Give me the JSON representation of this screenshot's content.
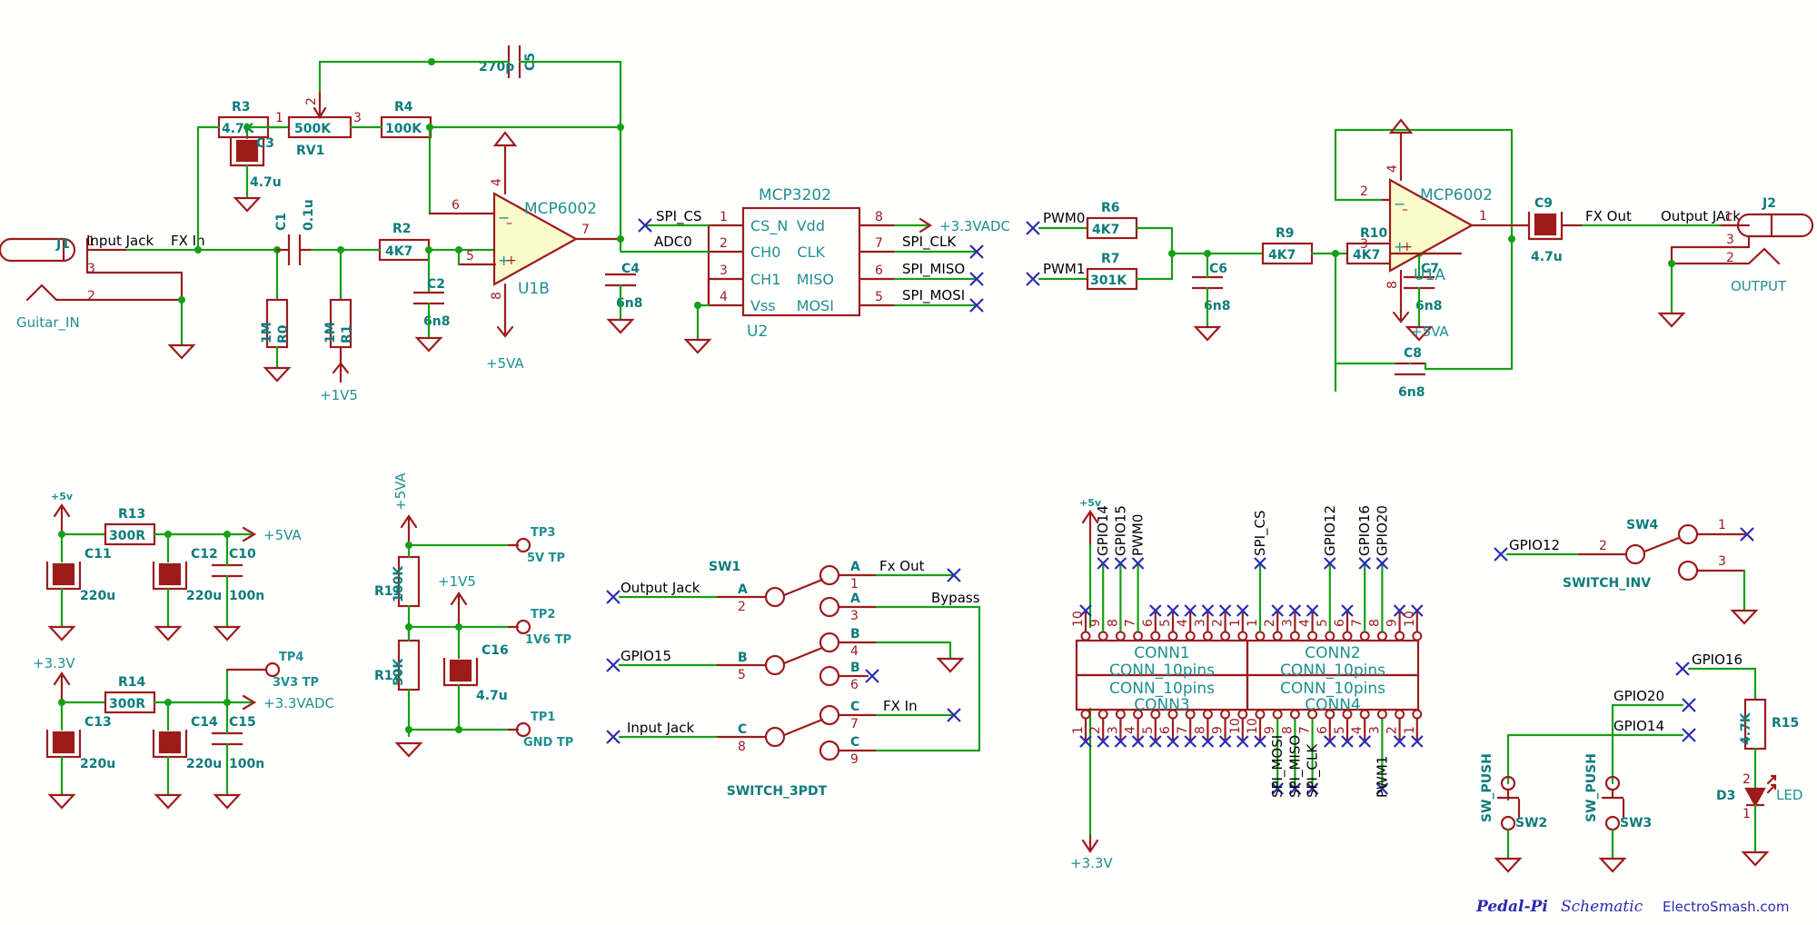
{
  "sheet": {
    "title": "Pedal-Pi Schematic",
    "credit_brand": "Pedal-Pi",
    "credit_word": "Schematic",
    "credit_site": "ElectroSmash.com",
    "colors": {
      "wire_green": "#14a014",
      "symbol_red": "#9d1b1b",
      "label_teal": "#1f8f8f",
      "net_black": "#000000",
      "nc_blue": "#2b2bb0",
      "opamp_fill": "#fafaca",
      "background": "#ffffff"
    }
  },
  "input_stage": {
    "j1_ref": "J1",
    "j1_name": "Guitar_IN",
    "j1_pins": [
      "1",
      "3",
      "2"
    ],
    "net_input_jack": "Input Jack",
    "net_fx_in": "FX In",
    "c1_ref": "C1",
    "c1_val": "0.1u",
    "r0_ref": "R0",
    "r0_val": "1M",
    "r1_ref": "R1",
    "r1_val": "1M",
    "r2_ref": "R2",
    "r2_val": "4K7",
    "c2_ref": "C2",
    "c2_val": "6n8",
    "c3_ref": "C3",
    "c3_val": "4.7u",
    "r3_ref": "R3",
    "r3_val": "4.7K",
    "rv1_ref": "RV1",
    "rv1_val": "500K",
    "rv1_pins": [
      "1",
      "2",
      "3"
    ],
    "r4_ref": "R4",
    "r4_val": "100K",
    "c5_ref": "C5",
    "c5_val": "270p",
    "c4_ref": "C4",
    "c4_val": "6n8",
    "u1b_ref": "U1B",
    "u1b_part": "MCP6002",
    "u1b_pins": [
      "6",
      "5",
      "7",
      "4",
      "8"
    ],
    "pwr_1v5": "+1V5",
    "pwr_5va": "+5VA"
  },
  "adc": {
    "ref": "U2",
    "part": "MCP3202",
    "pins_left": [
      {
        "num": "1",
        "name": "CS_N"
      },
      {
        "num": "2",
        "name": "CH0"
      },
      {
        "num": "3",
        "name": "CH1"
      },
      {
        "num": "4",
        "name": "Vss"
      }
    ],
    "pins_right": [
      {
        "num": "8",
        "name": "Vdd"
      },
      {
        "num": "7",
        "name": "CLK"
      },
      {
        "num": "6",
        "name": "MISO"
      },
      {
        "num": "5",
        "name": "MOSI"
      }
    ],
    "net_cs": "SPI_CS",
    "net_adc0": "ADC0",
    "net_vdd": "+3.3VADC",
    "net_clk": "SPI_CLK",
    "net_miso": "SPI_MISO",
    "net_mosi": "SPI_MOSI"
  },
  "output_stage": {
    "net_pwm0": "PWM0",
    "net_pwm1": "PWM1",
    "r6_ref": "R6",
    "r6_val": "4K7",
    "r7_ref": "R7",
    "r7_val": "301K",
    "c6_ref": "C6",
    "c6_val": "6n8",
    "r9_ref": "R9",
    "r9_val": "4K7",
    "r10_ref": "R10",
    "r10_val": "4K7",
    "c7_ref": "C7",
    "c7_val": "6n8",
    "c8_ref": "C8",
    "c8_val": "6n8",
    "u1a_ref": "U1A",
    "u1a_part": "MCP6002",
    "u1a_pins": [
      "2",
      "3",
      "1",
      "4",
      "8"
    ],
    "pwr_5va": "+5VA",
    "c9_ref": "C9",
    "c9_val": "4.7u",
    "net_fx_out": "FX Out",
    "net_output_jack": "Output JAck",
    "j2_ref": "J2",
    "j2_name": "OUTPUT",
    "j2_pins": [
      "1",
      "3",
      "2"
    ]
  },
  "psu_5v": {
    "rail_in": "+5v",
    "rail_out": "+5VA",
    "r13_ref": "R13",
    "r13_val": "300R",
    "c11_ref": "C11",
    "c11_val": "220u",
    "c12_ref": "C12",
    "c12_val": "220u",
    "c10_ref": "C10",
    "c10_val": "100n"
  },
  "psu_3v3": {
    "rail_in": "+3.3V",
    "rail_out": "+3.3VADC",
    "r14_ref": "R14",
    "r14_val": "300R",
    "c13_ref": "C13",
    "c13_val": "220u",
    "c14_ref": "C14",
    "c14_val": "220u",
    "c15_ref": "C15",
    "c15_val": "100n",
    "tp4_ref": "TP4",
    "tp4_name": "3V3 TP"
  },
  "bias": {
    "rail_in": "+5VA",
    "rail_out": "+1V5",
    "r11_ref": "R11",
    "r11_val": "100K",
    "r12_ref": "R12",
    "r12_val": "50K",
    "c16_ref": "C16",
    "c16_val": "4.7u",
    "tp3_ref": "TP3",
    "tp3_name": "5V TP",
    "tp2_ref": "TP2",
    "tp2_name": "1V6 TP",
    "tp1_ref": "TP1",
    "tp1_name": "GND TP"
  },
  "footswitch": {
    "ref": "SW1",
    "part": "SWITCH_3PDT",
    "in_rows": [
      {
        "net": "Output Jack",
        "pole": "A",
        "pin": "2"
      },
      {
        "net": "GPIO15",
        "pole": "B",
        "pin": "5"
      },
      {
        "net": "Input Jack",
        "pole": "C",
        "pin": "8"
      }
    ],
    "out_rows": [
      {
        "pole": "A",
        "pin": "1",
        "net": "Fx Out"
      },
      {
        "pole": "A",
        "pin": "3",
        "net": "Bypass"
      },
      {
        "pole": "B",
        "pin": "4",
        "net": ""
      },
      {
        "pole": "B",
        "pin": "6",
        "net": ""
      },
      {
        "pole": "C",
        "pin": "7",
        "net": "FX In"
      },
      {
        "pole": "C",
        "pin": "9",
        "net": ""
      }
    ]
  },
  "connectors": {
    "rail_top": "+5v",
    "rail_bottom": "+3.3V",
    "blocks": [
      {
        "ref": "CONN1",
        "part": "CONN_10pins"
      },
      {
        "ref": "CONN2",
        "part": "CONN_10pins"
      },
      {
        "ref": "CONN3",
        "part": "CONN_10pins"
      },
      {
        "ref": "CONN4",
        "part": "CONN_10pins"
      }
    ],
    "top_pin_numbers": [
      "10",
      "9",
      "8",
      "7",
      "6",
      "5",
      "4",
      "3",
      "2",
      "1",
      "1",
      "2",
      "3",
      "4",
      "5",
      "6",
      "7",
      "8",
      "9",
      "10"
    ],
    "bottom_pin_numbers": [
      "1",
      "2",
      "3",
      "4",
      "5",
      "6",
      "7",
      "8",
      "9",
      "10",
      "10",
      "9",
      "8",
      "7",
      "6",
      "5",
      "4",
      "3",
      "2",
      "1"
    ],
    "top_nets": [
      "GPIO14",
      "GPIO15",
      "PWM0",
      "SPI_CS",
      "GPIO12",
      "GPIO16",
      "GPIO20"
    ],
    "bottom_nets": [
      "SPI_MOSI",
      "SPI_MISO",
      "SPI_CLK",
      "PWM1"
    ]
  },
  "invert_switch": {
    "net_in": "GPIO12",
    "ref": "SW4",
    "part": "SWITCH_INV",
    "pins": [
      "2",
      "1",
      "3"
    ]
  },
  "buttons_led": {
    "net_gpio16": "GPIO16",
    "net_gpio20": "GPIO20",
    "net_gpio14": "GPIO14",
    "sw2_ref": "SW2",
    "sw2_part": "SW_PUSH",
    "sw3_ref": "SW3",
    "sw3_part": "SW_PUSH",
    "r15_ref": "R15",
    "r15_val": "4.7K",
    "d3_ref": "D3",
    "d3_name": "LED",
    "d3_pins": [
      "2",
      "1"
    ]
  }
}
